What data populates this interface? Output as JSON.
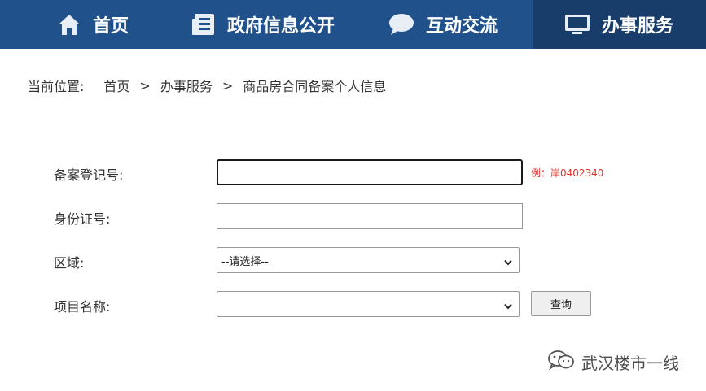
{
  "nav": {
    "home": "首页",
    "gov": "政府信息公开",
    "interact": "互动交流",
    "service": "办事服务"
  },
  "breadcrumb": {
    "label": "当前位置:",
    "home": "首页",
    "service": "办事服务",
    "current": "商品房合同备案个人信息",
    "separator": ">"
  },
  "form": {
    "record_no_label": "备案登记号:",
    "record_no_value": "",
    "record_no_hint": "例：岸0402340",
    "id_label": "身份证号:",
    "id_value": "",
    "area_label": "区域:",
    "area_selected": "--请选择--",
    "project_label": "项目名称:",
    "project_selected": "",
    "query_button": "查询"
  },
  "watermark": {
    "text": "武汉楼市一线"
  },
  "colors": {
    "nav_bg": "#20518a",
    "nav_active_bg": "#183d6a",
    "hint": "#e0302a"
  }
}
